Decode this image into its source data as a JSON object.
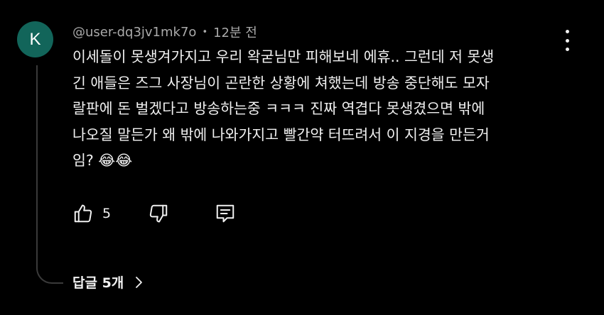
{
  "comment": {
    "avatar_letter": "K",
    "avatar_color": "#12655a",
    "username": "@user-dq3jv1mk7o",
    "separator": "•",
    "timestamp": "12분 전",
    "lines": [
      "이세돌이 못생겨가지고 우리 왁굳님만 피해보네 에휴.. 그런데 저 못생",
      "긴 애들은 즈그 사장님이 곤란한 상황에 쳐했는데 방송 중단해도 모자",
      "랄판에 돈 벌겠다고 방송하는중 ㅋㅋㅋ 진짜 역겹다 못생겼으면 밖에",
      "나오질 말든가 왜 밖에 나와가지고 빨간약 터뜨려서 이 지경을 만든거",
      "임? 😂😂"
    ],
    "like_count": "5",
    "replies_label": "답글 5개",
    "icons": {
      "more": "more-vert-icon",
      "like": "thumbs-up-icon",
      "dislike": "thumbs-down-icon",
      "reply": "comment-reply-icon",
      "chevron": "chevron-right-icon"
    }
  }
}
